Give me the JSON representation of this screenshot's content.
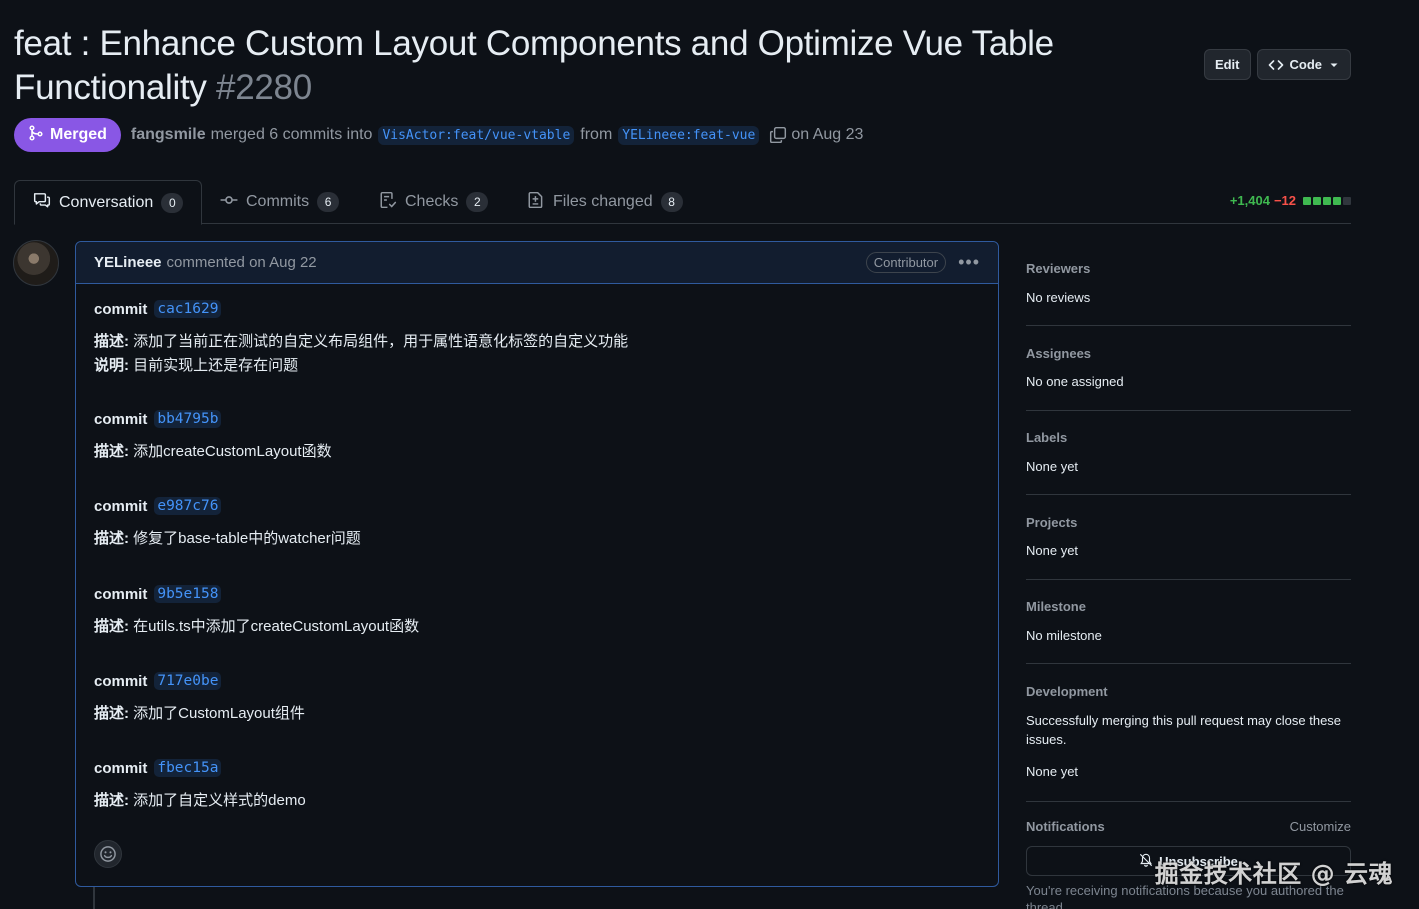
{
  "pr": {
    "title": "feat : Enhance Custom Layout Components and Optimize Vue Table Functionality",
    "number": "#2280",
    "state_label": "Merged",
    "author": "fangsmile",
    "merge_text": "merged 6 commits into",
    "base_branch": "VisActor:feat/vue-vtable",
    "from_text": "from",
    "head_branch": "YELineee:feat-vue",
    "date_text": "on Aug 23"
  },
  "header_actions": {
    "edit_label": "Edit",
    "code_label": "Code"
  },
  "tabs": [
    {
      "label": "Conversation",
      "count": "0"
    },
    {
      "label": "Commits",
      "count": "6"
    },
    {
      "label": "Checks",
      "count": "2"
    },
    {
      "label": "Files changed",
      "count": "8"
    }
  ],
  "diffstat": {
    "additions": "+1,404",
    "deletions": "−12",
    "blocks": [
      "#3fb950",
      "#3fb950",
      "#3fb950",
      "#3fb950",
      "#30363d"
    ]
  },
  "comment": {
    "author": "YELineee",
    "meta": "commented on Aug 22",
    "role": "Contributor",
    "commit_word": "commit",
    "commits": [
      {
        "sha": "cac1629",
        "lines": [
          {
            "key": "描述:",
            "text": "添加了当前正在测试的自定义布局组件，用于属性语意化标签的自定义功能"
          },
          {
            "key": "说明:",
            "text": "目前实现上还是存在问题"
          }
        ]
      },
      {
        "sha": "bb4795b",
        "lines": [
          {
            "key": "描述:",
            "text": "添加createCustomLayout函数"
          }
        ]
      },
      {
        "sha": "e987c76",
        "lines": [
          {
            "key": "描述:",
            "text": "修复了base-table中的watcher问题"
          }
        ]
      },
      {
        "sha": "9b5e158",
        "lines": [
          {
            "key": "描述:",
            "text": "在utils.ts中添加了createCustomLayout函数"
          }
        ]
      },
      {
        "sha": "717e0be",
        "lines": [
          {
            "key": "描述:",
            "text": "添加了CustomLayout组件"
          }
        ]
      },
      {
        "sha": "fbec15a",
        "lines": [
          {
            "key": "描述:",
            "text": "添加了自定义样式的demo"
          }
        ]
      }
    ]
  },
  "sidebar": {
    "reviewers": {
      "title": "Reviewers",
      "value": "No reviews"
    },
    "assignees": {
      "title": "Assignees",
      "value": "No one assigned"
    },
    "labels": {
      "title": "Labels",
      "value": "None yet"
    },
    "projects": {
      "title": "Projects",
      "value": "None yet"
    },
    "milestone": {
      "title": "Milestone",
      "value": "No milestone"
    },
    "development": {
      "title": "Development",
      "note": "Successfully merging this pull request may close these issues.",
      "value": "None yet"
    },
    "notifications": {
      "title": "Notifications",
      "customize": "Customize",
      "button": "Unsubscribe",
      "note": "You're receiving notifications because you authored the thread."
    }
  },
  "watermark": "掘金技术社区 @ 云魂",
  "colors": {
    "accent": "#4493f8",
    "merged": "#8957e5",
    "bg": "#0d1117"
  }
}
